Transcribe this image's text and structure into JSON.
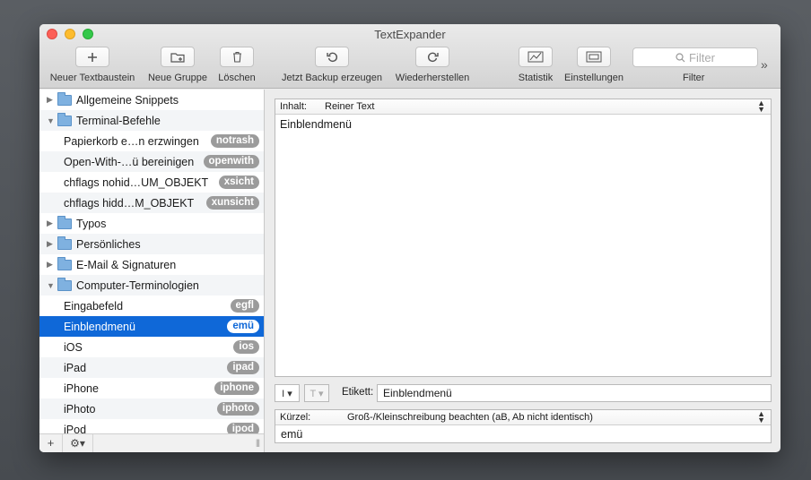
{
  "window": {
    "title": "TextExpander"
  },
  "toolbar": {
    "new_snippet": "Neuer Textbaustein",
    "new_group": "Neue Gruppe",
    "delete": "Löschen",
    "backup": "Jetzt Backup erzeugen",
    "restore": "Wiederherstellen",
    "stats": "Statistik",
    "settings": "Einstellungen",
    "filter_placeholder": "Filter",
    "filter_label": "Filter",
    "overflow": "»"
  },
  "sidebar": {
    "items": [
      {
        "kind": "group",
        "label": "Allgemeine Snippets",
        "expanded": false
      },
      {
        "kind": "group",
        "label": "Terminal-Befehle",
        "expanded": true
      },
      {
        "kind": "snippet",
        "label": "Papierkorb e…n erzwingen",
        "abbr": "notrash"
      },
      {
        "kind": "snippet",
        "label": "Open-With-…ü bereinigen",
        "abbr": "openwith"
      },
      {
        "kind": "snippet",
        "label": "chflags nohid…UM_OBJEKT",
        "abbr": "xsicht"
      },
      {
        "kind": "snippet",
        "label": "chflags hidd…M_OBJEKT",
        "abbr": "xunsicht"
      },
      {
        "kind": "group",
        "label": "Typos",
        "expanded": false
      },
      {
        "kind": "group",
        "label": "Persönliches",
        "expanded": false
      },
      {
        "kind": "group",
        "label": "E-Mail & Signaturen",
        "expanded": false
      },
      {
        "kind": "group",
        "label": "Computer-Terminologien",
        "expanded": true
      },
      {
        "kind": "snippet",
        "label": "Eingabefeld",
        "abbr": "egfl"
      },
      {
        "kind": "snippet",
        "label": "Einblendmenü",
        "abbr": "emü",
        "selected": true
      },
      {
        "kind": "snippet",
        "label": "iOS",
        "abbr": "ios"
      },
      {
        "kind": "snippet",
        "label": "iPad",
        "abbr": "ipad"
      },
      {
        "kind": "snippet",
        "label": "iPhone",
        "abbr": "iphone"
      },
      {
        "kind": "snippet",
        "label": "iPhoto",
        "abbr": "iphoto"
      },
      {
        "kind": "snippet",
        "label": "iPod",
        "abbr": "ipod"
      }
    ],
    "footer": {
      "add": "+",
      "gear": "⚙▾",
      "handle": "|||"
    }
  },
  "editor": {
    "content_label": "Inhalt:",
    "content_type": "Reiner Text",
    "body": "Einblendmenü",
    "label_caption": "Etikett:",
    "label_value": "Einblendmenü",
    "abbr_caption": "Kürzel:",
    "case_option": "Groß-/Kleinschreibung beachten (aB, Ab nicht identisch)",
    "abbr_value": "emü"
  },
  "colors": {
    "selection": "#0f68d8",
    "badge": "#9b9b9b"
  }
}
